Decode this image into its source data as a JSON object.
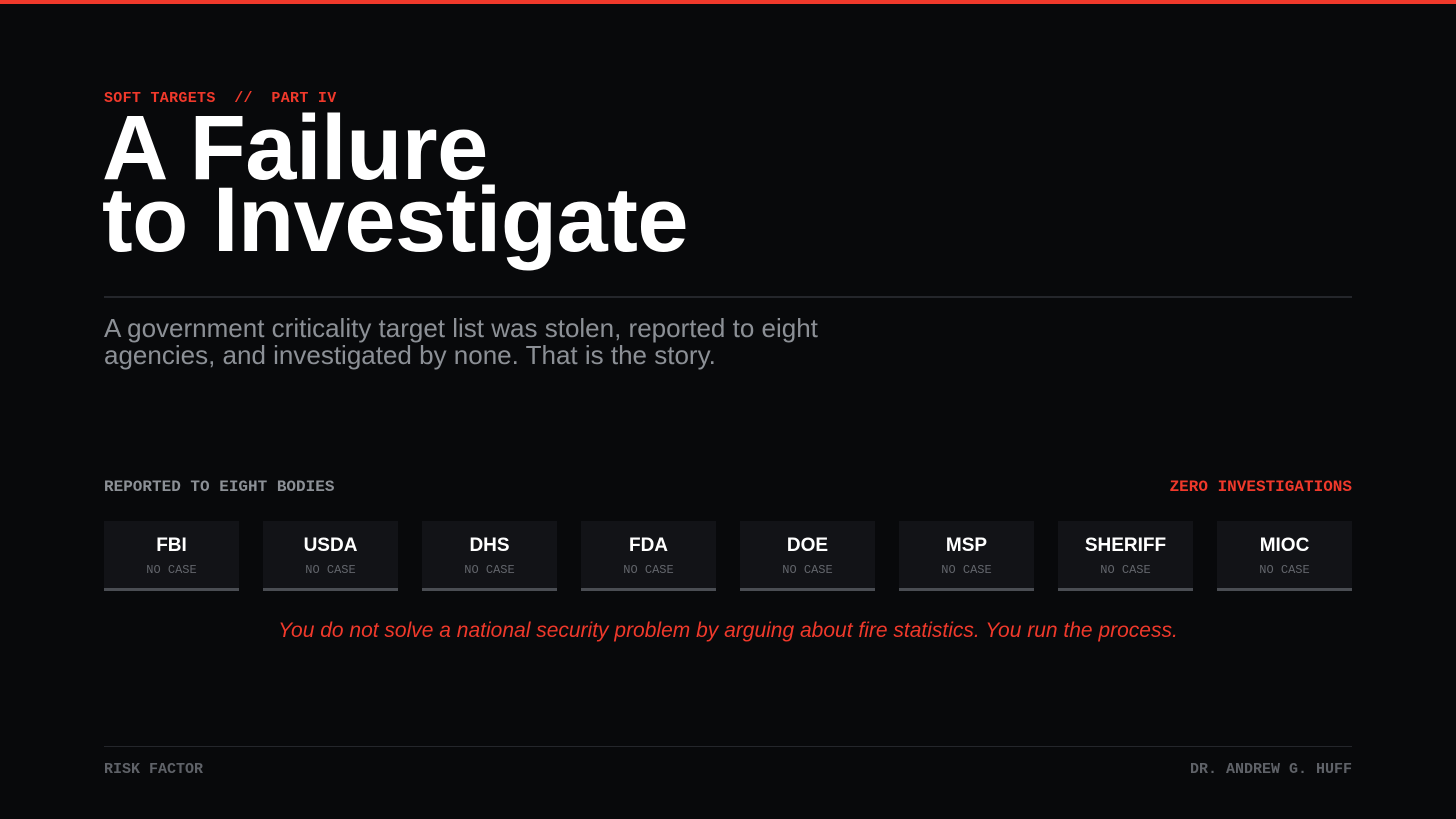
{
  "header": {
    "kicker": "SOFT TARGETS  //  PART IV",
    "title_line_1": "A Failure",
    "title_line_2": "to Investigate",
    "subtitle": "A government criticality target list was stolen, reported to eight agencies, and investigated by none. That is the story."
  },
  "agency_section": {
    "label_left": "REPORTED TO EIGHT BODIES",
    "label_right": "ZERO INVESTIGATIONS",
    "agencies": [
      {
        "name": "FBI",
        "status": "NO CASE"
      },
      {
        "name": "USDA",
        "status": "NO CASE"
      },
      {
        "name": "DHS",
        "status": "NO CASE"
      },
      {
        "name": "FDA",
        "status": "NO CASE"
      },
      {
        "name": "DOE",
        "status": "NO CASE"
      },
      {
        "name": "MSP",
        "status": "NO CASE"
      },
      {
        "name": "SHERIFF",
        "status": "NO CASE"
      },
      {
        "name": "MIOC",
        "status": "NO CASE"
      }
    ]
  },
  "quote": "You do not solve a national security problem by arguing about fire statistics. You run the process.",
  "footer": {
    "left": "RISK FACTOR",
    "right": "DR. ANDREW G. HUFF"
  },
  "colors": {
    "background": "#08090b",
    "accent": "#f0392b",
    "title": "#ffffff",
    "muted": "#8c9096"
  }
}
